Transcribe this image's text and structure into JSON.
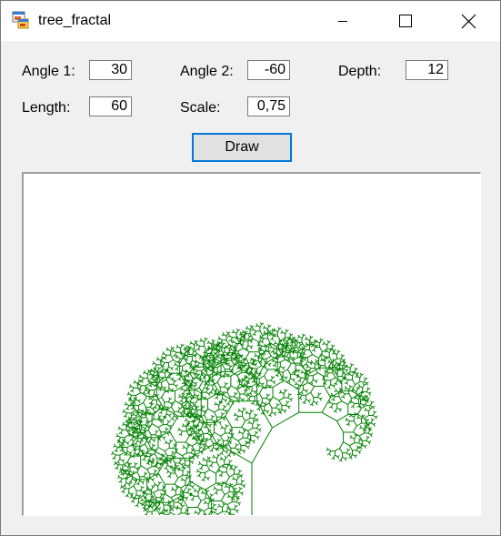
{
  "window": {
    "title": "tree_fractal",
    "icon": "windows-forms-app-icon",
    "controls": [
      "minimize-icon",
      "maximize-icon",
      "close-icon"
    ]
  },
  "form": {
    "angle1": {
      "label": "Angle 1:",
      "value": "30"
    },
    "angle2": {
      "label": "Angle 2:",
      "value": "-60"
    },
    "depth": {
      "label": "Depth:",
      "value": "12"
    },
    "length": {
      "label": "Length:",
      "value": "60"
    },
    "scale": {
      "label": "Scale:",
      "value": "0,75"
    },
    "draw_label": "Draw"
  },
  "canvas": {
    "background": "#ffffff",
    "branch_color": "#008000"
  },
  "colors": {
    "form_background": "#f0f0f0",
    "titlebar_background": "#ffffff",
    "button_background": "#e1e1e1",
    "focus_border": "#0078d7"
  }
}
